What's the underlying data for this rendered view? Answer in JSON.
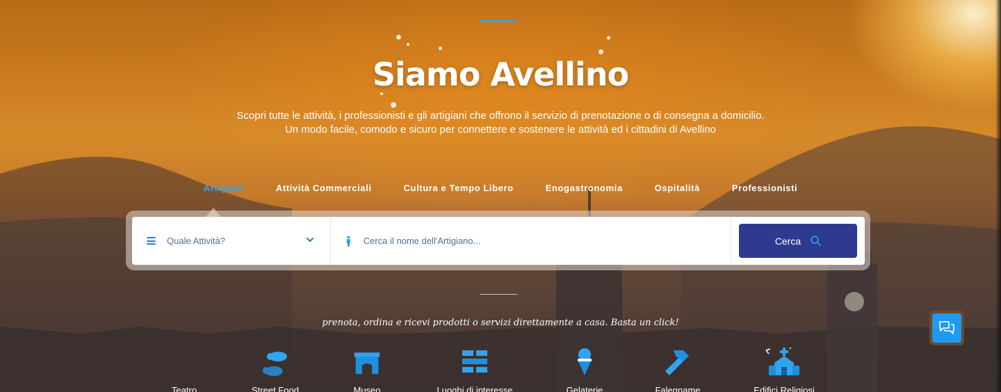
{
  "hero": {
    "title": "Siamo Avellino",
    "subtitle_line1": "Scopri tutte le attività, i professionisti e gli artigiani che offrono il servizio di prenotazione o di consegna a domicilio.",
    "subtitle_line2": "Un modo facile, comodo e sicuro per connettere e sostenere le attività ed i cittadini di Avellino"
  },
  "tabs": [
    {
      "label": "Artigiani",
      "active": true
    },
    {
      "label": "Attività Commerciali",
      "active": false
    },
    {
      "label": "Cultura e Tempo Libero",
      "active": false
    },
    {
      "label": "Enogastronomia",
      "active": false
    },
    {
      "label": "Ospitalità",
      "active": false
    },
    {
      "label": "Professionisti",
      "active": false
    }
  ],
  "search": {
    "activity_placeholder": "Quale Attività?",
    "name_placeholder": "Cerca il nome dell'Artigiano...",
    "button_label": "Cerca"
  },
  "tagline": "prenota, ordina e ricevi prodotti o servizi direttamente a casa. Basta un click!",
  "categories": [
    {
      "label": "Teatro",
      "icon": "theater-icon"
    },
    {
      "label": "Street Food",
      "icon": "footsteps-icon"
    },
    {
      "label": "Museo",
      "icon": "arch-icon"
    },
    {
      "label": "Luoghi di interesse",
      "icon": "brick-wall-icon"
    },
    {
      "label": "Gelaterie",
      "icon": "ice-cream-icon"
    },
    {
      "label": "Falegname",
      "icon": "hammer-icon"
    },
    {
      "label": "Edifici Religiosi",
      "icon": "church-icon"
    }
  ],
  "colors": {
    "accent": "#2fa5f0",
    "button": "#2e3a8e",
    "chat": "#1e9bf0"
  }
}
